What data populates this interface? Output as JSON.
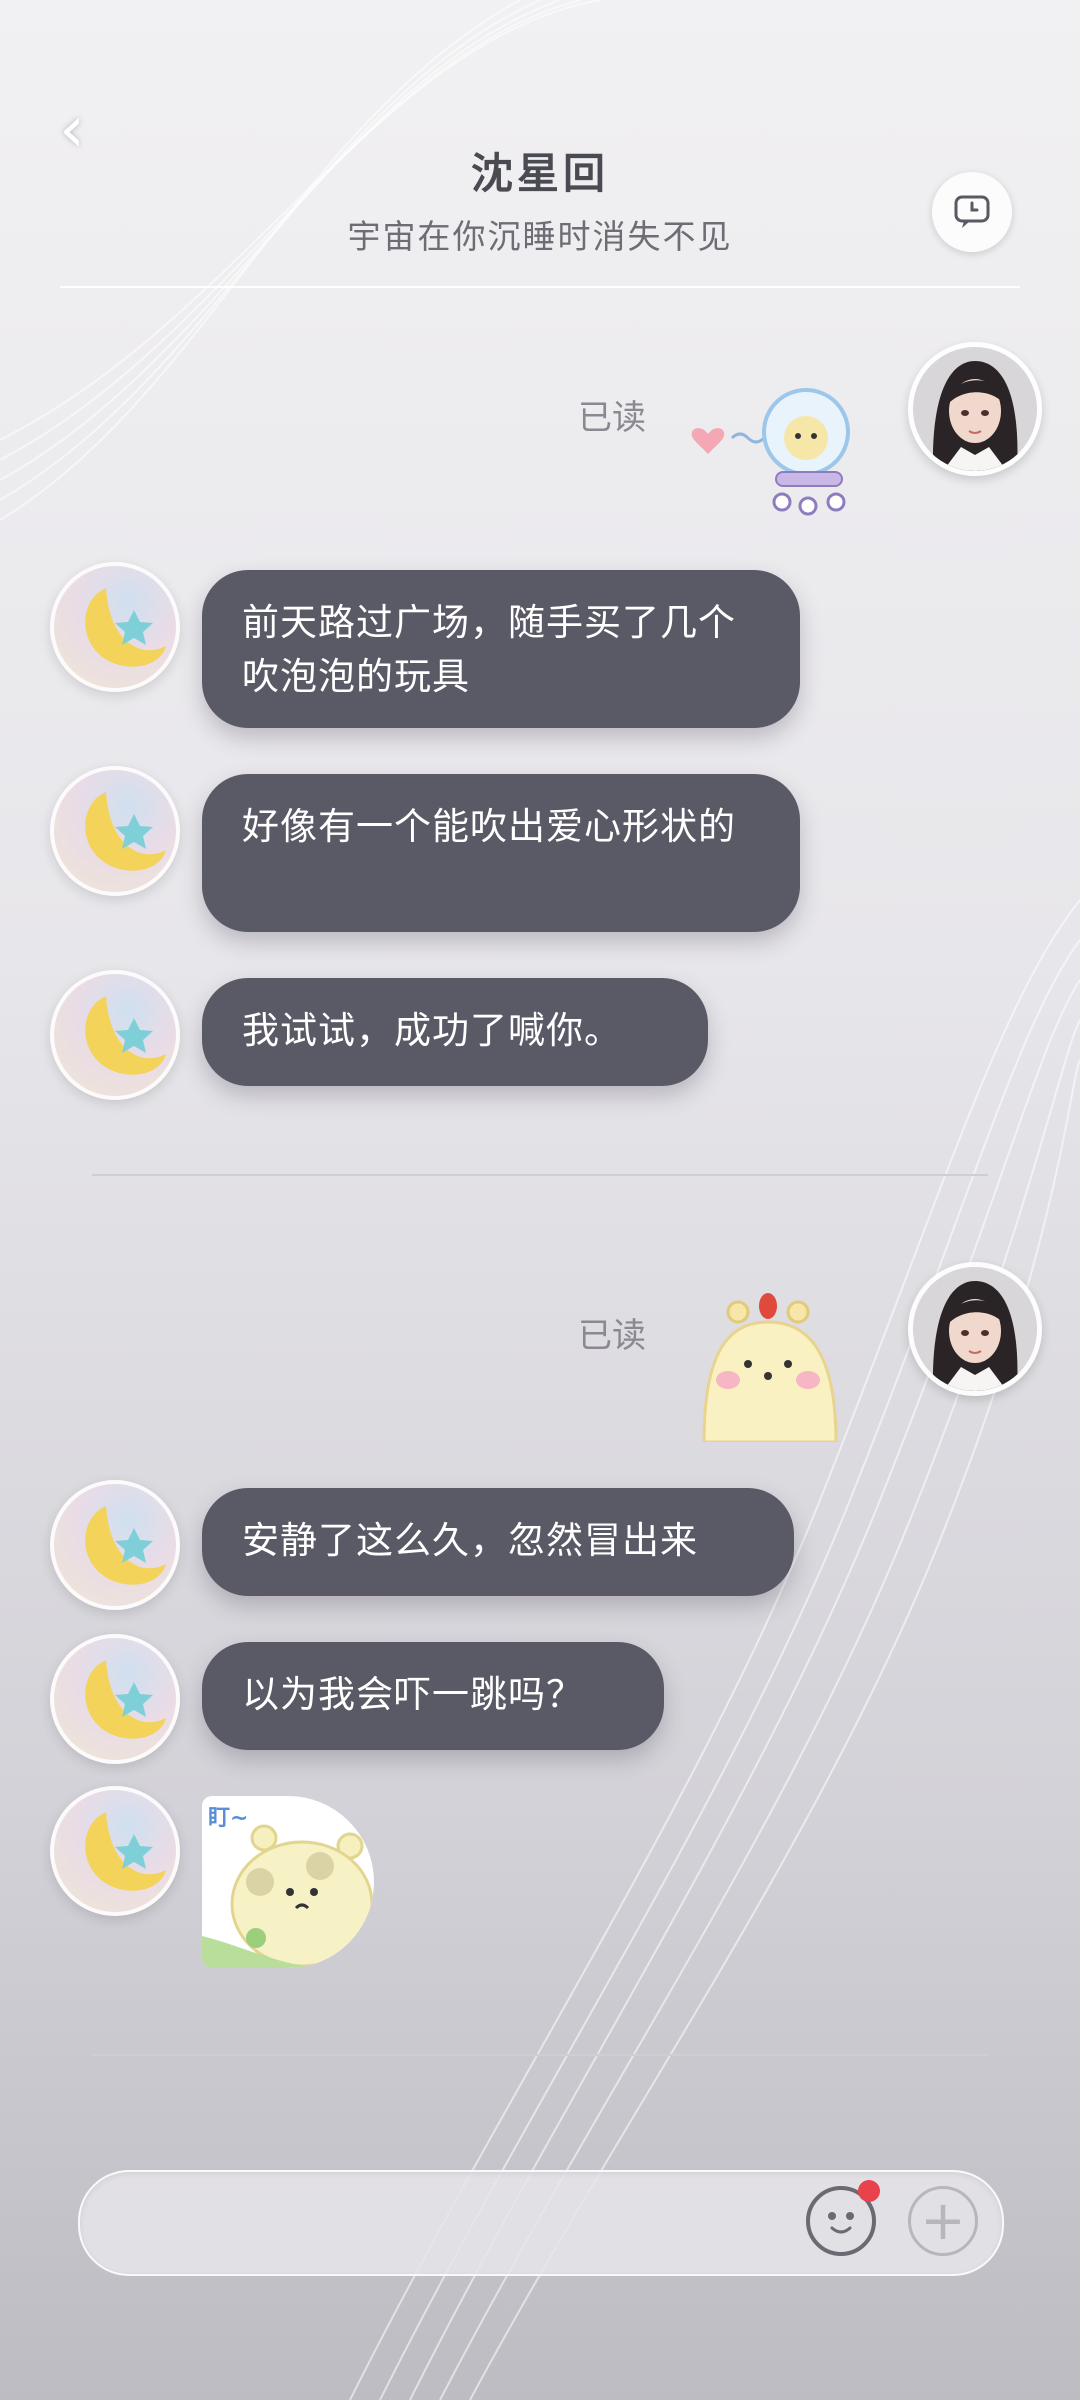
{
  "header": {
    "back_icon": "chevron-left-icon",
    "title": "沈星回",
    "subtitle": "宇宙在你沉睡时消失不见",
    "action_icon": "message-history-icon"
  },
  "messages": {
    "group1": {
      "read_status": "已读",
      "sticker": "astronaut-bear-sticker",
      "replies": [
        "前天路过广场，随手买了几个吹泡泡的玩具",
        "好像有一个能吹出爱心形状的",
        "我试试，成功了喊你。"
      ]
    },
    "group2": {
      "read_status": "已读",
      "sticker": "yellow-creature-sticker",
      "replies": [
        "安静了这么久，忽然冒出来",
        "以为我会吓一跳吗？"
      ],
      "reply_sticker_text": "盯~"
    }
  },
  "input": {
    "emoji_icon": "emoji-face-icon",
    "plus_icon": "plus-icon",
    "notification_color": "#e8434d"
  },
  "colors": {
    "bubble": "#5a5a66",
    "bubble_text": "#ffffff",
    "read_text": "#8a8991"
  }
}
